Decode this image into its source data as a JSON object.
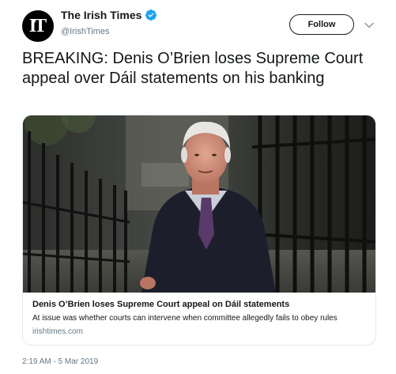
{
  "account": {
    "avatar_text": "IT",
    "display_name": "The Irish Times",
    "handle": "@IrishTimes",
    "verified": true,
    "verified_icon": "verified-badge-icon",
    "verified_color": "#1da1f2"
  },
  "follow_label": "Follow",
  "menu_icon": "chevron-down-icon",
  "tweet": {
    "text": "BREAKING: Denis O’Brien loses Supreme Court appeal over Dáil statements on his banking"
  },
  "card": {
    "image": "photo-of-man-in-dark-coat-on-street",
    "title": "Denis O’Brien loses Supreme Court appeal on Dáil statements",
    "description": "At issue was whether courts can intervene when committee allegedly fails to obey rules",
    "domain": "irishtimes.com"
  },
  "timestamp": "2:19 AM - 5 Mar 2019",
  "colors": {
    "text": "#14171a",
    "secondary": "#657786",
    "border": "#e1e8ed"
  }
}
